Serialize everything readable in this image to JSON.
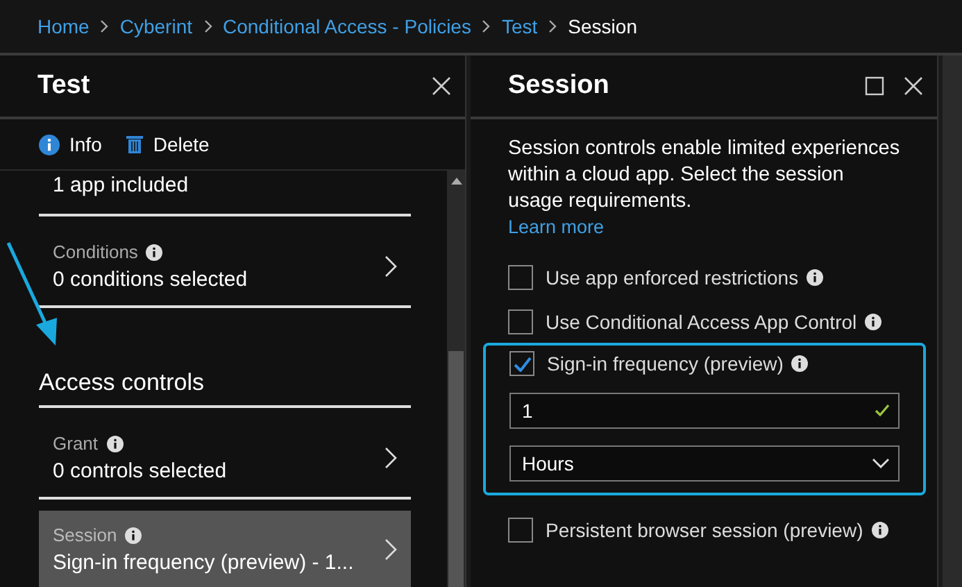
{
  "breadcrumb": [
    {
      "label": "Home",
      "current": false
    },
    {
      "label": "Cyberint",
      "current": false
    },
    {
      "label": "Conditional Access - Policies",
      "current": false
    },
    {
      "label": "Test",
      "current": false
    },
    {
      "label": "Session",
      "current": true
    }
  ],
  "left_blade": {
    "title": "Test",
    "toolbar": [
      {
        "kind": "info",
        "label": "Info"
      },
      {
        "kind": "delete",
        "label": "Delete"
      }
    ],
    "items": [
      {
        "kind": "item",
        "value": "1 app included",
        "selected": false
      },
      {
        "kind": "item",
        "label": "Conditions",
        "value": "0 conditions selected",
        "selected": false
      },
      {
        "kind": "heading",
        "label": "Access controls"
      },
      {
        "kind": "item",
        "label": "Grant",
        "value": "0 controls selected",
        "selected": false
      },
      {
        "kind": "item",
        "label": "Session",
        "value": "Sign-in frequency (preview) - 1...",
        "selected": true
      }
    ]
  },
  "right_blade": {
    "title": "Session",
    "description": "Session controls enable limited experiences within a cloud app. Select the session usage requirements.",
    "learn_more": "Learn more",
    "options": [
      {
        "label": "Use app enforced restrictions",
        "checked": false,
        "highlighted": false
      },
      {
        "label": "Use Conditional Access App Control",
        "checked": false,
        "highlighted": false
      },
      {
        "label": "Sign-in frequency (preview)",
        "checked": true,
        "highlighted": true,
        "value": "1",
        "valid": true,
        "unit": "Hours"
      },
      {
        "label": "Persistent browser session (preview)",
        "checked": false,
        "highlighted": false
      }
    ]
  }
}
